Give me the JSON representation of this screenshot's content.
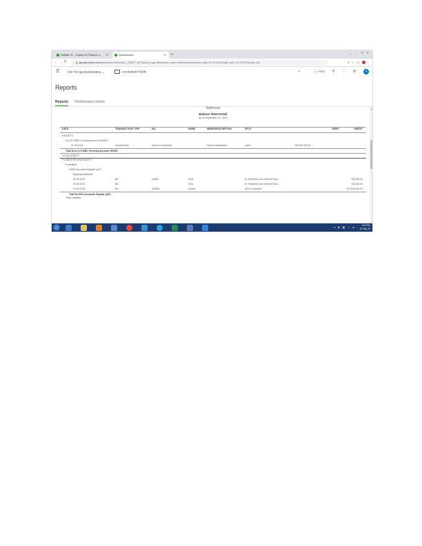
{
  "browser": {
    "tabs": [
      {
        "label": "Saifalur R. - Expert in Finance a...",
        "favicon_color": "#14a800"
      },
      {
        "label": "QuickBooks",
        "favicon_color": "#2ca01c"
      }
    ],
    "url_host": "app.qbo.intuit.com",
    "url_path": "/app/reports?token=BAL_SHEET_DET&show_logo=false&date_macro=thismonthtodate&low_date=01-09-2023&high_date=22-09-2023&cash_ba..."
  },
  "qbo_header": {
    "goto_label": "GO TO QUICKBOOKS",
    "accountant_tools_label": "Accountant Tools",
    "help_label": "Help",
    "avatar_letter": "S"
  },
  "page": {
    "title": "Reports",
    "tabs": [
      "Reports",
      "Performance centre"
    ]
  },
  "report": {
    "company": "Saitexus",
    "title": "Balance Sheet Detail",
    "date": "As of September 22, 2023",
    "columns": [
      "DATE",
      "TRANSACTION TYPE",
      "NO.",
      "NAME",
      "MEMO/DESCRIPTION",
      "SPLIT",
      "DEBIT",
      "CREDIT"
    ],
    "rows": [
      {
        "date": "▾ ASSETS",
        "type": "",
        "no": "",
        "name": "",
        "memo": "",
        "split": "",
        "debit": "",
        "credit": ""
      },
      {
        "date": "▾ In-01 HSBC Checking Account 163994",
        "type": "",
        "no": "",
        "name": "",
        "memo": "",
        "split": "",
        "debit": "",
        "credit": ""
      },
      {
        "date": "01-09-2023",
        "type": "Journal Entry",
        "no": "Owners Investment",
        "name": "",
        "memo": "Owners Investment",
        "split": "-Split-",
        "debit": "Tk8,000,000.00",
        "credit": ""
      },
      {
        "date": "Total for In-01 HSBC Checking Account 163994",
        "type": "",
        "no": "",
        "name": "",
        "memo": "",
        "split": "",
        "debit": "",
        "credit": ""
      },
      {
        "date": "TOTAL ASSETS",
        "type": "",
        "no": "",
        "name": "",
        "memo": "",
        "split": "",
        "debit": "",
        "credit": ""
      },
      {
        "date": "▾ LIABILITIES AND EQUITY",
        "type": "",
        "no": "",
        "name": "",
        "memo": "",
        "split": "",
        "debit": "",
        "credit": ""
      },
      {
        "date": "▾ Liabilities",
        "type": "",
        "no": "",
        "name": "",
        "memo": "",
        "split": "",
        "debit": "",
        "credit": ""
      },
      {
        "date": "▾ 5002 Accounts Payable (A/P)",
        "type": "",
        "no": "",
        "name": "",
        "memo": "",
        "split": "",
        "debit": "",
        "credit": ""
      },
      {
        "date": "Beginning Balance",
        "type": "",
        "no": "",
        "name": "",
        "memo": "",
        "split": "",
        "debit": "",
        "credit": ""
      },
      {
        "date": "05-09-2023",
        "type": "Bill",
        "no": "14258",
        "name": "AT&t",
        "memo": "",
        "split": "01 Telephone and Internet Expe...",
        "debit": "",
        "credit": "Tk6,000.00"
      },
      {
        "date": "05-09-2023",
        "type": "Bill",
        "no": "",
        "name": "AT&t",
        "memo": "",
        "split": "01 Telephone and Internet Expe...",
        "debit": "",
        "credit": "Tk6,000.00"
      },
      {
        "date": "19-09-2023",
        "type": "Bill",
        "no": "415894",
        "name": "ADAM",
        "memo": "",
        "split": "5201 Purchases",
        "debit": "",
        "credit": "Tk1,500,000.00"
      },
      {
        "date": "Total for 5002 Accounts Payable (A/P)",
        "type": "",
        "no": "",
        "name": "",
        "memo": "",
        "split": "",
        "debit": "",
        "credit": ""
      },
      {
        "date": "Total Liabilities",
        "type": "",
        "no": "",
        "name": "",
        "memo": "",
        "split": "",
        "debit": "",
        "credit": ""
      }
    ]
  },
  "taskbar": {
    "time": "4:43 PM",
    "date": "22-Sep-23"
  },
  "colors": {
    "brand_green": "#2ca01c",
    "brand_blue": "#0077c5",
    "taskbar": "#1b3b6f"
  }
}
